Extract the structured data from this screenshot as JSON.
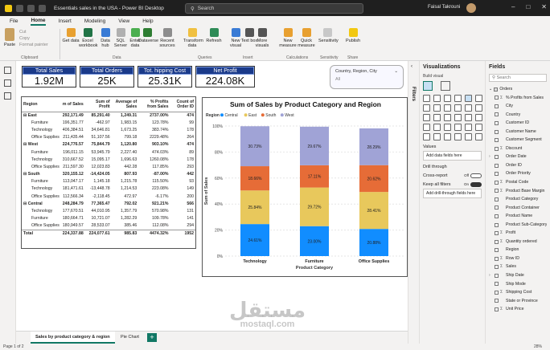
{
  "window": {
    "title": "Essentials sales in the USA - Power BI Desktop",
    "search_placeholder": "Search",
    "user": "Faisal Takrouni"
  },
  "menu": [
    "File",
    "Home",
    "Insert",
    "Modeling",
    "View",
    "Help"
  ],
  "ribbon": {
    "paste": "Paste",
    "cut": "Cut",
    "copy": "Copy",
    "format_painter": "Format painter",
    "buttons": [
      {
        "label": "Get data",
        "icon": "database-icon",
        "color": "#e8a030"
      },
      {
        "label": "Excel workbook",
        "icon": "excel-icon",
        "color": "#217346"
      },
      {
        "label": "Data hub",
        "icon": "hub-icon",
        "color": "#3a7bd5"
      },
      {
        "label": "SQL Server",
        "icon": "sql-icon",
        "color": "#b0b0b0"
      },
      {
        "label": "Enter data",
        "icon": "table-icon",
        "color": "#4caf50"
      },
      {
        "label": "Dataverse",
        "icon": "dataverse-icon",
        "color": "#2e7d32"
      },
      {
        "label": "Recent sources",
        "icon": "recent-icon",
        "color": "#8d8d8d"
      },
      {
        "label": "Transform data",
        "icon": "transform-icon",
        "color": "#f0c040"
      },
      {
        "label": "Refresh",
        "icon": "refresh-icon",
        "color": "#2e8b57"
      },
      {
        "label": "New visual",
        "icon": "chart-icon",
        "color": "#3a7bd5"
      },
      {
        "label": "Text box",
        "icon": "textbox-icon",
        "color": "#555555"
      },
      {
        "label": "More visuals",
        "icon": "visuals-icon",
        "color": "#555555"
      },
      {
        "label": "New measure",
        "icon": "measure-icon",
        "color": "#e8a030"
      },
      {
        "label": "Quick measure",
        "icon": "quick-measure-icon",
        "color": "#e8a030"
      },
      {
        "label": "Sensitivity",
        "icon": "shield-icon",
        "color": "#c8c8c8"
      },
      {
        "label": "Publish",
        "icon": "publish-icon",
        "color": "#f2c811"
      }
    ],
    "groups": [
      "Clipboard",
      "Data",
      "Queries",
      "Insert",
      "Calculations",
      "Sensitivity",
      "Share"
    ]
  },
  "cards": [
    {
      "title": "Total Sales",
      "value": "1.92M"
    },
    {
      "title": "Total Orders",
      "value": "25K"
    },
    {
      "title": "Tot. hipping Cost",
      "value": "25.31K"
    },
    {
      "title": "Net Profit",
      "value": "224.08K"
    }
  ],
  "slicer": {
    "label": "Country, Region, City",
    "value": "All"
  },
  "matrix": {
    "headers": [
      "Region",
      "m of Sales",
      "Sum of Profit",
      "Average of Sales",
      "% Profits from Sales",
      "Count of Order ID"
    ],
    "rows": [
      {
        "type": "grp",
        "cells": [
          "⊟ East",
          "292,171.49",
          "85,291.40",
          "1,249.31",
          "2737.00%",
          "474"
        ]
      },
      {
        "type": "sub",
        "cells": [
          "Furniture",
          "196,351.77",
          "-462.97",
          "1,983.15",
          "123.78%",
          "99"
        ]
      },
      {
        "type": "sub",
        "cells": [
          "Technology",
          "406,384.51",
          "34,646.81",
          "1,673.25",
          "383.74%",
          "178"
        ]
      },
      {
        "type": "sub",
        "cells": [
          "Office Supplies",
          "211,435.44",
          "51,107.56",
          "799.18",
          "2229.48%",
          "264"
        ]
      },
      {
        "type": "grp",
        "cells": [
          "⊟ West",
          "224,776.57",
          "75,844.79",
          "1,120.80",
          "903.10%",
          "474"
        ]
      },
      {
        "type": "sub",
        "cells": [
          "Furniture",
          "196,011.15",
          "53,945.79",
          "2,227.40",
          "474.03%",
          "89"
        ]
      },
      {
        "type": "sub",
        "cells": [
          "Technology",
          "310,667.52",
          "15,095.17",
          "1,696.63",
          "1260.08%",
          "178"
        ]
      },
      {
        "type": "sub",
        "cells": [
          "Office Supplies",
          "211,597.30",
          "12,023.83",
          "442.28",
          "117.85%",
          "293"
        ]
      },
      {
        "type": "grp",
        "cells": [
          "⊟ South",
          "320,155.12",
          "-14,424.05",
          "807.93",
          "-87.00%",
          "442"
        ]
      },
      {
        "type": "sub",
        "cells": [
          "Furniture",
          "113,047.17",
          "1,145.18",
          "1,215.78",
          "115.50%",
          "93"
        ]
      },
      {
        "type": "sub",
        "cells": [
          "Technology",
          "181,471.61",
          "-13,448.78",
          "1,214.53",
          "223.08%",
          "149"
        ]
      },
      {
        "type": "sub",
        "cells": [
          "Office Supplies",
          "112,566.34",
          "-2,118.45",
          "472.97",
          "-6.17%",
          "200"
        ]
      },
      {
        "type": "grp",
        "cells": [
          "⊟ Central",
          "248,284.79",
          "77,365.47",
          "792.02",
          "921.21%",
          "566"
        ]
      },
      {
        "type": "sub",
        "cells": [
          "Technology",
          "177,670.51",
          "44,010.95",
          "1,357.79",
          "570.98%",
          "131"
        ]
      },
      {
        "type": "sub",
        "cells": [
          "Furniture",
          "180,664.71",
          "10,721.07",
          "1,282.29",
          "109.78%",
          "141"
        ]
      },
      {
        "type": "sub",
        "cells": [
          "Office Supplies",
          "180,949.57",
          "28,533.07",
          "385.46",
          "112.08%",
          "294"
        ]
      },
      {
        "type": "tot",
        "cells": [
          "Total",
          "224,337.88",
          "224,077.61",
          "985.83",
          "4474.32%",
          "1952"
        ]
      }
    ]
  },
  "chart_data": {
    "type": "bar",
    "title": "Sum of Sales by Product Category and Region",
    "xlabel": "Product Category",
    "ylabel": "Sum of Sales",
    "legend_title": "Region",
    "legend_position": "top-left",
    "categories": [
      "Technology",
      "Furniture",
      "Office Supplies"
    ],
    "ylim": [
      0,
      100
    ],
    "yticks": [
      "0%",
      "20%",
      "40%",
      "60%",
      "80%",
      "100%"
    ],
    "series": [
      {
        "name": "Central",
        "color": "#118dff",
        "values": [
          24.61,
          23.0,
          20.88
        ],
        "labels": [
          "24.61%",
          "23.00%",
          "20.88%"
        ]
      },
      {
        "name": "East",
        "color": "#e8c85c",
        "values": [
          25.84,
          29.72,
          28.41
        ],
        "labels": [
          "25.84%",
          "29.72%",
          "28.41%"
        ]
      },
      {
        "name": "South",
        "color": "#e66c37",
        "values": [
          18.66,
          17.11,
          20.62
        ],
        "labels": [
          "18.66%",
          "17.11%",
          "20.62%"
        ]
      },
      {
        "name": "West",
        "color": "#a0a3d6",
        "values": [
          30.73,
          29.67,
          28.29
        ],
        "labels": [
          "30.73%",
          "29.67%",
          "28.29%"
        ]
      }
    ]
  },
  "pages": {
    "tabs": [
      "Sales by product category & region",
      "Pie Chart"
    ],
    "add": "+",
    "status": "Page 1 of 2",
    "zoom": "28%"
  },
  "filters_label": "Filters",
  "viz_pane": {
    "title": "Visualizations",
    "build_visual": "Build visual",
    "values_label": "Values",
    "add_fields": "Add data fields here",
    "drillthrough": "Drill through",
    "cross_report": "Cross-report",
    "cross_report_state": "Off",
    "keep_filters": "Keep all filters",
    "keep_filters_state": "On",
    "add_drillthrough": "Add drill-through fields here"
  },
  "fields_pane": {
    "title": "Fields",
    "search_placeholder": "Search",
    "table": "Orders",
    "fields": [
      {
        "name": "% Profits from Sales",
        "sigma": true,
        "expand": false
      },
      {
        "name": "City",
        "sigma": false,
        "expand": false
      },
      {
        "name": "Country",
        "sigma": false,
        "expand": false
      },
      {
        "name": "Customer ID",
        "sigma": false,
        "expand": false
      },
      {
        "name": "Customer Name",
        "sigma": false,
        "expand": false
      },
      {
        "name": "Customer Segment",
        "sigma": false,
        "expand": false
      },
      {
        "name": "Discount",
        "sigma": true,
        "expand": false
      },
      {
        "name": "Order Date",
        "sigma": false,
        "expand": true
      },
      {
        "name": "Order ID",
        "sigma": false,
        "expand": false
      },
      {
        "name": "Order Priority",
        "sigma": false,
        "expand": false
      },
      {
        "name": "Postal Code",
        "sigma": true,
        "expand": false
      },
      {
        "name": "Product Base Margin",
        "sigma": true,
        "expand": false
      },
      {
        "name": "Product Category",
        "sigma": false,
        "expand": false
      },
      {
        "name": "Product Container",
        "sigma": false,
        "expand": false
      },
      {
        "name": "Product Name",
        "sigma": false,
        "expand": false
      },
      {
        "name": "Product Sub-Category",
        "sigma": false,
        "expand": false
      },
      {
        "name": "Profit",
        "sigma": true,
        "expand": false
      },
      {
        "name": "Quantity ordered",
        "sigma": true,
        "expand": false
      },
      {
        "name": "Region",
        "sigma": false,
        "expand": false
      },
      {
        "name": "Row ID",
        "sigma": true,
        "expand": false
      },
      {
        "name": "Sales",
        "sigma": true,
        "expand": false
      },
      {
        "name": "Ship Date",
        "sigma": false,
        "expand": true
      },
      {
        "name": "Ship Mode",
        "sigma": false,
        "expand": false
      },
      {
        "name": "Shipping Cost",
        "sigma": true,
        "expand": false
      },
      {
        "name": "State or Province",
        "sigma": false,
        "expand": false
      },
      {
        "name": "Unit Price",
        "sigma": true,
        "expand": false
      }
    ]
  },
  "watermark": {
    "arabic": "مستقل",
    "latin": "mostaql.com"
  }
}
